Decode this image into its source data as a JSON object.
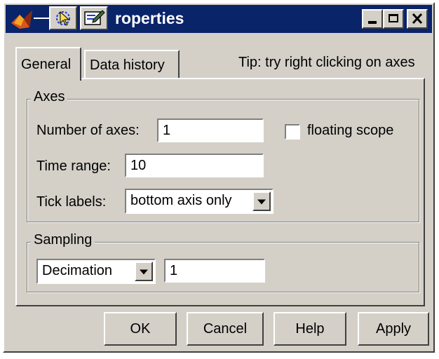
{
  "window": {
    "title": "roperties",
    "title_color": "#0a246a",
    "face_color": "#d4d0c8"
  },
  "titlebar_icons": [
    "matlab-icon",
    "pointer-cursor-icon",
    "edit-icon"
  ],
  "caption_buttons": [
    "minimize-icon",
    "maximize-icon",
    "close-icon"
  ],
  "tabs": [
    {
      "label": "General",
      "active": true
    },
    {
      "label": "Data history",
      "active": false
    }
  ],
  "tip": "Tip: try right clicking on axes",
  "axes": {
    "legend": "Axes",
    "num_axes_label": "Number of axes:",
    "num_axes_value": "1",
    "floating_label": "floating scope",
    "floating_checked": false,
    "time_range_label": "Time range:",
    "time_range_value": "10",
    "tick_labels_label": "Tick labels:",
    "tick_labels_value": "bottom axis only"
  },
  "sampling": {
    "legend": "Sampling",
    "mode_value": "Decimation",
    "factor_value": "1"
  },
  "buttons": {
    "ok": "OK",
    "cancel": "Cancel",
    "help": "Help",
    "apply": "Apply"
  }
}
